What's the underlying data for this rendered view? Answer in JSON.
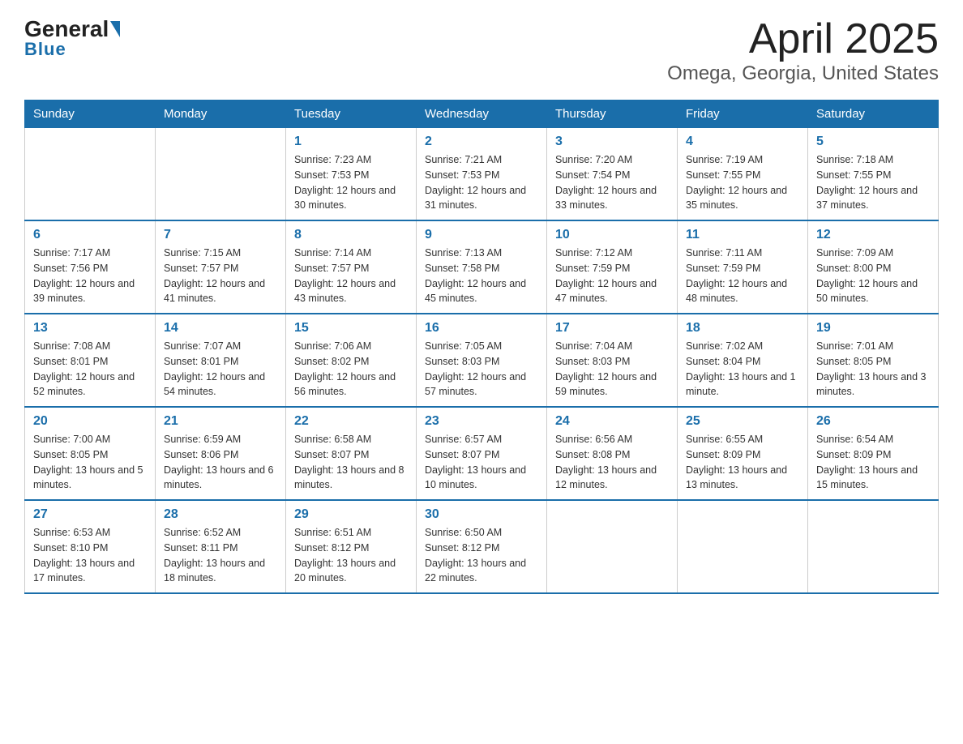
{
  "header": {
    "logo_general": "General",
    "logo_blue": "Blue",
    "title": "April 2025",
    "subtitle": "Omega, Georgia, United States"
  },
  "weekdays": [
    "Sunday",
    "Monday",
    "Tuesday",
    "Wednesday",
    "Thursday",
    "Friday",
    "Saturday"
  ],
  "weeks": [
    [
      {
        "day": "",
        "sunrise": "",
        "sunset": "",
        "daylight": ""
      },
      {
        "day": "",
        "sunrise": "",
        "sunset": "",
        "daylight": ""
      },
      {
        "day": "1",
        "sunrise": "Sunrise: 7:23 AM",
        "sunset": "Sunset: 7:53 PM",
        "daylight": "Daylight: 12 hours and 30 minutes."
      },
      {
        "day": "2",
        "sunrise": "Sunrise: 7:21 AM",
        "sunset": "Sunset: 7:53 PM",
        "daylight": "Daylight: 12 hours and 31 minutes."
      },
      {
        "day": "3",
        "sunrise": "Sunrise: 7:20 AM",
        "sunset": "Sunset: 7:54 PM",
        "daylight": "Daylight: 12 hours and 33 minutes."
      },
      {
        "day": "4",
        "sunrise": "Sunrise: 7:19 AM",
        "sunset": "Sunset: 7:55 PM",
        "daylight": "Daylight: 12 hours and 35 minutes."
      },
      {
        "day": "5",
        "sunrise": "Sunrise: 7:18 AM",
        "sunset": "Sunset: 7:55 PM",
        "daylight": "Daylight: 12 hours and 37 minutes."
      }
    ],
    [
      {
        "day": "6",
        "sunrise": "Sunrise: 7:17 AM",
        "sunset": "Sunset: 7:56 PM",
        "daylight": "Daylight: 12 hours and 39 minutes."
      },
      {
        "day": "7",
        "sunrise": "Sunrise: 7:15 AM",
        "sunset": "Sunset: 7:57 PM",
        "daylight": "Daylight: 12 hours and 41 minutes."
      },
      {
        "day": "8",
        "sunrise": "Sunrise: 7:14 AM",
        "sunset": "Sunset: 7:57 PM",
        "daylight": "Daylight: 12 hours and 43 minutes."
      },
      {
        "day": "9",
        "sunrise": "Sunrise: 7:13 AM",
        "sunset": "Sunset: 7:58 PM",
        "daylight": "Daylight: 12 hours and 45 minutes."
      },
      {
        "day": "10",
        "sunrise": "Sunrise: 7:12 AM",
        "sunset": "Sunset: 7:59 PM",
        "daylight": "Daylight: 12 hours and 47 minutes."
      },
      {
        "day": "11",
        "sunrise": "Sunrise: 7:11 AM",
        "sunset": "Sunset: 7:59 PM",
        "daylight": "Daylight: 12 hours and 48 minutes."
      },
      {
        "day": "12",
        "sunrise": "Sunrise: 7:09 AM",
        "sunset": "Sunset: 8:00 PM",
        "daylight": "Daylight: 12 hours and 50 minutes."
      }
    ],
    [
      {
        "day": "13",
        "sunrise": "Sunrise: 7:08 AM",
        "sunset": "Sunset: 8:01 PM",
        "daylight": "Daylight: 12 hours and 52 minutes."
      },
      {
        "day": "14",
        "sunrise": "Sunrise: 7:07 AM",
        "sunset": "Sunset: 8:01 PM",
        "daylight": "Daylight: 12 hours and 54 minutes."
      },
      {
        "day": "15",
        "sunrise": "Sunrise: 7:06 AM",
        "sunset": "Sunset: 8:02 PM",
        "daylight": "Daylight: 12 hours and 56 minutes."
      },
      {
        "day": "16",
        "sunrise": "Sunrise: 7:05 AM",
        "sunset": "Sunset: 8:03 PM",
        "daylight": "Daylight: 12 hours and 57 minutes."
      },
      {
        "day": "17",
        "sunrise": "Sunrise: 7:04 AM",
        "sunset": "Sunset: 8:03 PM",
        "daylight": "Daylight: 12 hours and 59 minutes."
      },
      {
        "day": "18",
        "sunrise": "Sunrise: 7:02 AM",
        "sunset": "Sunset: 8:04 PM",
        "daylight": "Daylight: 13 hours and 1 minute."
      },
      {
        "day": "19",
        "sunrise": "Sunrise: 7:01 AM",
        "sunset": "Sunset: 8:05 PM",
        "daylight": "Daylight: 13 hours and 3 minutes."
      }
    ],
    [
      {
        "day": "20",
        "sunrise": "Sunrise: 7:00 AM",
        "sunset": "Sunset: 8:05 PM",
        "daylight": "Daylight: 13 hours and 5 minutes."
      },
      {
        "day": "21",
        "sunrise": "Sunrise: 6:59 AM",
        "sunset": "Sunset: 8:06 PM",
        "daylight": "Daylight: 13 hours and 6 minutes."
      },
      {
        "day": "22",
        "sunrise": "Sunrise: 6:58 AM",
        "sunset": "Sunset: 8:07 PM",
        "daylight": "Daylight: 13 hours and 8 minutes."
      },
      {
        "day": "23",
        "sunrise": "Sunrise: 6:57 AM",
        "sunset": "Sunset: 8:07 PM",
        "daylight": "Daylight: 13 hours and 10 minutes."
      },
      {
        "day": "24",
        "sunrise": "Sunrise: 6:56 AM",
        "sunset": "Sunset: 8:08 PM",
        "daylight": "Daylight: 13 hours and 12 minutes."
      },
      {
        "day": "25",
        "sunrise": "Sunrise: 6:55 AM",
        "sunset": "Sunset: 8:09 PM",
        "daylight": "Daylight: 13 hours and 13 minutes."
      },
      {
        "day": "26",
        "sunrise": "Sunrise: 6:54 AM",
        "sunset": "Sunset: 8:09 PM",
        "daylight": "Daylight: 13 hours and 15 minutes."
      }
    ],
    [
      {
        "day": "27",
        "sunrise": "Sunrise: 6:53 AM",
        "sunset": "Sunset: 8:10 PM",
        "daylight": "Daylight: 13 hours and 17 minutes."
      },
      {
        "day": "28",
        "sunrise": "Sunrise: 6:52 AM",
        "sunset": "Sunset: 8:11 PM",
        "daylight": "Daylight: 13 hours and 18 minutes."
      },
      {
        "day": "29",
        "sunrise": "Sunrise: 6:51 AM",
        "sunset": "Sunset: 8:12 PM",
        "daylight": "Daylight: 13 hours and 20 minutes."
      },
      {
        "day": "30",
        "sunrise": "Sunrise: 6:50 AM",
        "sunset": "Sunset: 8:12 PM",
        "daylight": "Daylight: 13 hours and 22 minutes."
      },
      {
        "day": "",
        "sunrise": "",
        "sunset": "",
        "daylight": ""
      },
      {
        "day": "",
        "sunrise": "",
        "sunset": "",
        "daylight": ""
      },
      {
        "day": "",
        "sunrise": "",
        "sunset": "",
        "daylight": ""
      }
    ]
  ]
}
